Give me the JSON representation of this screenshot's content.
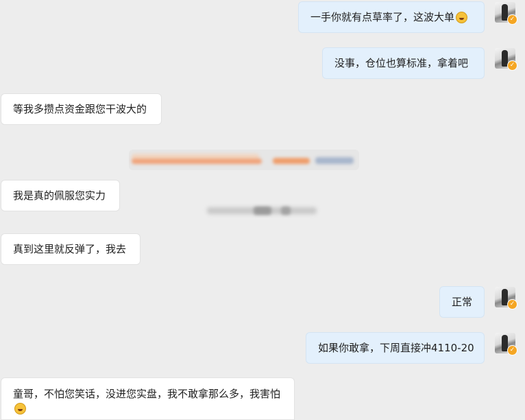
{
  "messages": [
    {
      "side": "right",
      "text": "一手你就有点草率了，这波大单",
      "emoji": "grinning-sweat-emoji"
    },
    {
      "side": "right",
      "text": "没事，仓位也算标准，拿着吧"
    },
    {
      "side": "left",
      "text": "等我多攒点资金跟您干波大的"
    },
    {
      "side": "left",
      "text": "我是真的佩服您实力"
    },
    {
      "side": "left",
      "text": "真到这里就反弹了，我去"
    },
    {
      "side": "right",
      "text": "正常"
    },
    {
      "side": "right",
      "text": "如果你敢拿，下周直接冲4110-20"
    },
    {
      "side": "left",
      "text": "童哥，不怕您笑话，没进您实盘，我不敢拿那么多，我害怕",
      "emoji": "face-with-hand-over-mouth-emoji"
    }
  ],
  "avatar": {
    "icon": "user-avatar",
    "badge": "✓",
    "badge_color": "#f5a623"
  },
  "colors": {
    "background": "#ededed",
    "right_bubble": "#e3f0fc",
    "left_bubble": "#ffffff",
    "accent": "#f5a623"
  }
}
